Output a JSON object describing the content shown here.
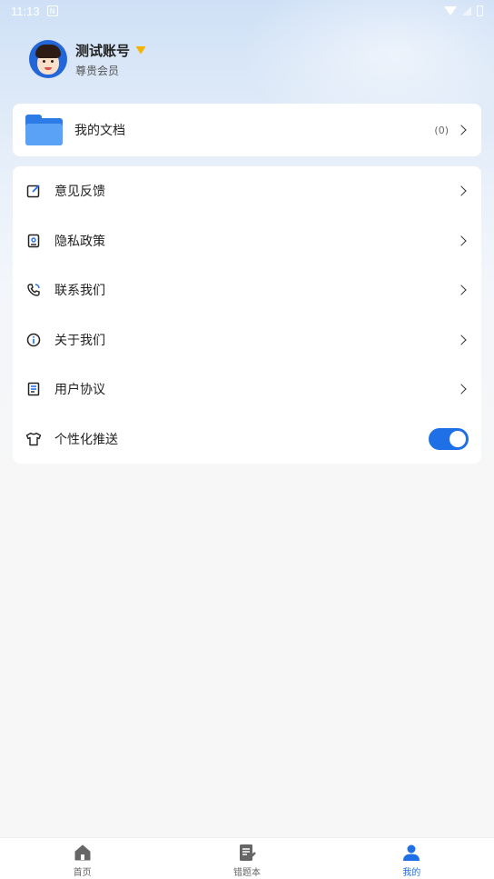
{
  "status_bar": {
    "time": "11:13",
    "notification_glyph": "N"
  },
  "profile": {
    "name": "测试账号",
    "membership": "尊贵会员"
  },
  "documents": {
    "label": "我的文档",
    "count": "(0)"
  },
  "menu": [
    {
      "label": "意见反馈",
      "icon": "edit-icon"
    },
    {
      "label": "隐私政策",
      "icon": "privacy-icon"
    },
    {
      "label": "联系我们",
      "icon": "phone-icon"
    },
    {
      "label": "关于我们",
      "icon": "info-icon"
    },
    {
      "label": "用户协议",
      "icon": "agreement-icon"
    }
  ],
  "personalized_push": {
    "label": "个性化推送",
    "enabled": true
  },
  "tabbar": [
    {
      "label": "首页",
      "icon": "home-icon",
      "active": false
    },
    {
      "label": "错题本",
      "icon": "notebook-icon",
      "active": false
    },
    {
      "label": "我的",
      "icon": "profile-icon",
      "active": true
    }
  ],
  "colors": {
    "accent": "#1f6fe6",
    "folder": "#2d7be6"
  }
}
